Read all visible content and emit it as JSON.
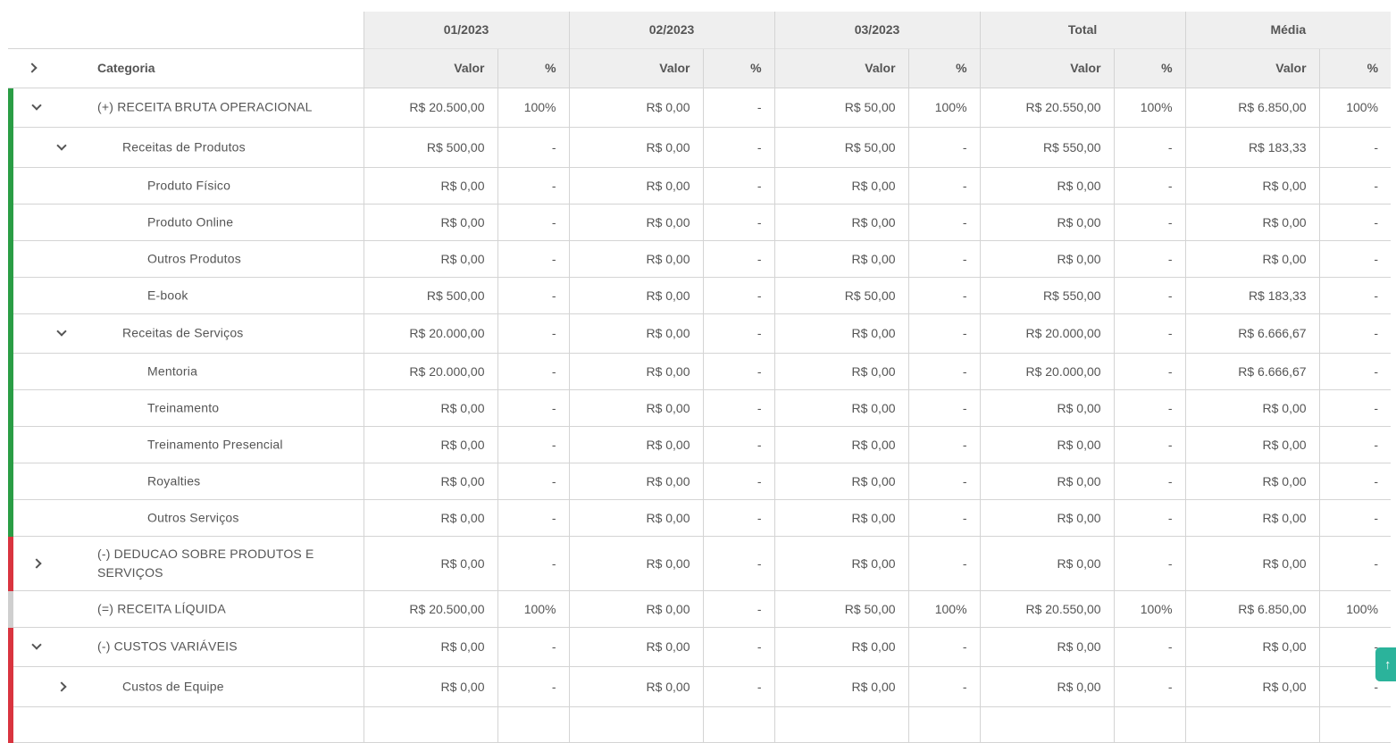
{
  "header": {
    "periods": [
      "01/2023",
      "02/2023",
      "03/2023",
      "Total",
      "Média"
    ],
    "category_label": "Categoria",
    "value_label": "Valor",
    "percent_label": "%"
  },
  "colors": {
    "revenue": "#2a9d45",
    "deduction": "#d9343f",
    "neutral": "#cfcfcf"
  },
  "rows": [
    {
      "label": "(+) RECEITA BRUTA OPERACIONAL",
      "level": 0,
      "toggle": "down",
      "color": "revenue",
      "height": 44,
      "cells": [
        [
          "R$ 20.500,00",
          "100%"
        ],
        [
          "R$ 0,00",
          "-"
        ],
        [
          "R$ 50,00",
          "100%"
        ],
        [
          "R$ 20.550,00",
          "100%"
        ],
        [
          "R$ 6.850,00",
          "100%"
        ]
      ]
    },
    {
      "label": "Receitas de Produtos",
      "level": 1,
      "toggle": "down",
      "color": "revenue",
      "height": 45,
      "cells": [
        [
          "R$ 500,00",
          "-"
        ],
        [
          "R$ 0,00",
          "-"
        ],
        [
          "R$ 50,00",
          "-"
        ],
        [
          "R$ 550,00",
          "-"
        ],
        [
          "R$ 183,33",
          "-"
        ]
      ]
    },
    {
      "label": "Produto Físico",
      "level": 2,
      "toggle": "",
      "color": "revenue",
      "height": 41,
      "cells": [
        [
          "R$ 0,00",
          "-"
        ],
        [
          "R$ 0,00",
          "-"
        ],
        [
          "R$ 0,00",
          "-"
        ],
        [
          "R$ 0,00",
          "-"
        ],
        [
          "R$ 0,00",
          "-"
        ]
      ]
    },
    {
      "label": "Produto Online",
      "level": 2,
      "toggle": "",
      "color": "revenue",
      "height": 41,
      "cells": [
        [
          "R$ 0,00",
          "-"
        ],
        [
          "R$ 0,00",
          "-"
        ],
        [
          "R$ 0,00",
          "-"
        ],
        [
          "R$ 0,00",
          "-"
        ],
        [
          "R$ 0,00",
          "-"
        ]
      ]
    },
    {
      "label": "Outros Produtos",
      "level": 2,
      "toggle": "",
      "color": "revenue",
      "height": 41,
      "cells": [
        [
          "R$ 0,00",
          "-"
        ],
        [
          "R$ 0,00",
          "-"
        ],
        [
          "R$ 0,00",
          "-"
        ],
        [
          "R$ 0,00",
          "-"
        ],
        [
          "R$ 0,00",
          "-"
        ]
      ]
    },
    {
      "label": "E-book",
      "level": 2,
      "toggle": "",
      "color": "revenue",
      "height": 41,
      "cells": [
        [
          "R$ 500,00",
          "-"
        ],
        [
          "R$ 0,00",
          "-"
        ],
        [
          "R$ 50,00",
          "-"
        ],
        [
          "R$ 550,00",
          "-"
        ],
        [
          "R$ 183,33",
          "-"
        ]
      ]
    },
    {
      "label": "Receitas de Serviços",
      "level": 1,
      "toggle": "down",
      "color": "revenue",
      "height": 44,
      "cells": [
        [
          "R$ 20.000,00",
          "-"
        ],
        [
          "R$ 0,00",
          "-"
        ],
        [
          "R$ 0,00",
          "-"
        ],
        [
          "R$ 20.000,00",
          "-"
        ],
        [
          "R$ 6.666,67",
          "-"
        ]
      ]
    },
    {
      "label": "Mentoria",
      "level": 2,
      "toggle": "",
      "color": "revenue",
      "height": 41,
      "cells": [
        [
          "R$ 20.000,00",
          "-"
        ],
        [
          "R$ 0,00",
          "-"
        ],
        [
          "R$ 0,00",
          "-"
        ],
        [
          "R$ 20.000,00",
          "-"
        ],
        [
          "R$ 6.666,67",
          "-"
        ]
      ]
    },
    {
      "label": "Treinamento",
      "level": 2,
      "toggle": "",
      "color": "revenue",
      "height": 41,
      "cells": [
        [
          "R$ 0,00",
          "-"
        ],
        [
          "R$ 0,00",
          "-"
        ],
        [
          "R$ 0,00",
          "-"
        ],
        [
          "R$ 0,00",
          "-"
        ],
        [
          "R$ 0,00",
          "-"
        ]
      ]
    },
    {
      "label": "Treinamento Presencial",
      "level": 2,
      "toggle": "",
      "color": "revenue",
      "height": 41,
      "cells": [
        [
          "R$ 0,00",
          "-"
        ],
        [
          "R$ 0,00",
          "-"
        ],
        [
          "R$ 0,00",
          "-"
        ],
        [
          "R$ 0,00",
          "-"
        ],
        [
          "R$ 0,00",
          "-"
        ]
      ]
    },
    {
      "label": "Royalties",
      "level": 2,
      "toggle": "",
      "color": "revenue",
      "height": 41,
      "cells": [
        [
          "R$ 0,00",
          "-"
        ],
        [
          "R$ 0,00",
          "-"
        ],
        [
          "R$ 0,00",
          "-"
        ],
        [
          "R$ 0,00",
          "-"
        ],
        [
          "R$ 0,00",
          "-"
        ]
      ]
    },
    {
      "label": "Outros Serviços",
      "level": 2,
      "toggle": "",
      "color": "revenue",
      "height": 41,
      "cells": [
        [
          "R$ 0,00",
          "-"
        ],
        [
          "R$ 0,00",
          "-"
        ],
        [
          "R$ 0,00",
          "-"
        ],
        [
          "R$ 0,00",
          "-"
        ],
        [
          "R$ 0,00",
          "-"
        ]
      ]
    },
    {
      "label": "(-) DEDUCAO SOBRE PRODUTOS E SERVIÇOS",
      "level": 0,
      "toggle": "right",
      "color": "deduction",
      "height": 61,
      "cells": [
        [
          "R$ 0,00",
          "-"
        ],
        [
          "R$ 0,00",
          "-"
        ],
        [
          "R$ 0,00",
          "-"
        ],
        [
          "R$ 0,00",
          "-"
        ],
        [
          "R$ 0,00",
          "-"
        ]
      ]
    },
    {
      "label": "(=) RECEITA LÍQUIDA",
      "level": 0,
      "toggle": "",
      "color": "neutral",
      "height": 41,
      "cells": [
        [
          "R$ 20.500,00",
          "100%"
        ],
        [
          "R$ 0,00",
          "-"
        ],
        [
          "R$ 50,00",
          "100%"
        ],
        [
          "R$ 20.550,00",
          "100%"
        ],
        [
          "R$ 6.850,00",
          "100%"
        ]
      ]
    },
    {
      "label": "(-) CUSTOS VARIÁVEIS",
      "level": 0,
      "toggle": "down",
      "color": "deduction",
      "height": 44,
      "cells": [
        [
          "R$ 0,00",
          "-"
        ],
        [
          "R$ 0,00",
          "-"
        ],
        [
          "R$ 0,00",
          "-"
        ],
        [
          "R$ 0,00",
          "-"
        ],
        [
          "R$ 0,00",
          "-"
        ]
      ]
    },
    {
      "label": "Custos de Equipe",
      "level": 1,
      "toggle": "right",
      "color": "deduction",
      "height": 45,
      "cells": [
        [
          "R$ 0,00",
          "-"
        ],
        [
          "R$ 0,00",
          "-"
        ],
        [
          "R$ 0,00",
          "-"
        ],
        [
          "R$ 0,00",
          "-"
        ],
        [
          "R$ 0,00",
          "-"
        ]
      ]
    },
    {
      "label": "",
      "level": 1,
      "toggle": "",
      "color": "deduction",
      "height": 40,
      "cells": [
        [
          "",
          ""
        ],
        [
          "",
          ""
        ],
        [
          "",
          ""
        ],
        [
          "",
          ""
        ],
        [
          "",
          ""
        ]
      ]
    }
  ],
  "scroll_top": {
    "glyph": "↑"
  }
}
